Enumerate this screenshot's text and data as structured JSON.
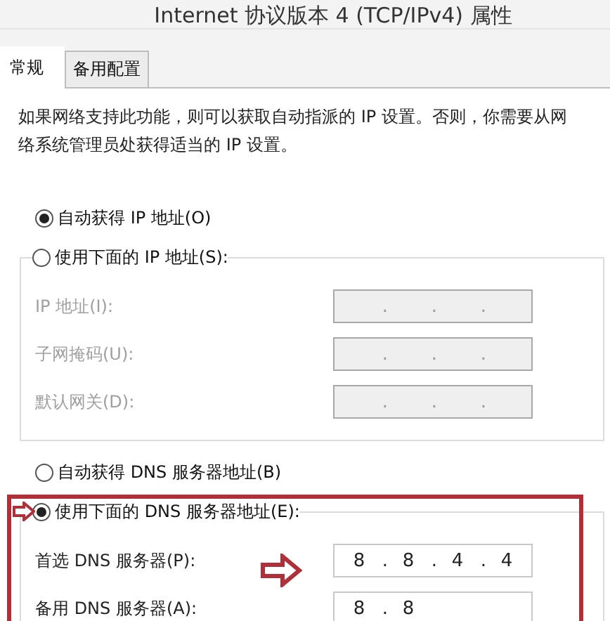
{
  "window": {
    "title": "Internet 协议版本 4 (TCP/IPv4) 属性"
  },
  "tabs": [
    {
      "label": "常规",
      "selected": true
    },
    {
      "label": "备用配置",
      "selected": false
    }
  ],
  "description": "如果网络支持此功能，则可以获取自动指派的 IP 设置。否则，你需要从网络系统管理员处获得适当的 IP 设置。",
  "ip_mode": [
    {
      "label": "自动获得 IP 地址(O)",
      "selected": true
    },
    {
      "label": "使用下面的 IP 地址(S):",
      "selected": false
    }
  ],
  "ip_fields": [
    {
      "label": "IP 地址(I):",
      "disabled": true,
      "separators": [
        ".",
        ".",
        "."
      ]
    },
    {
      "label": "子网掩码(U):",
      "disabled": true,
      "separators": [
        ".",
        ".",
        "."
      ]
    },
    {
      "label": "默认网关(D):",
      "disabled": true,
      "separators": [
        ".",
        ".",
        "."
      ]
    }
  ],
  "dns_mode": [
    {
      "label": "自动获得 DNS 服务器地址(B)",
      "selected": false
    },
    {
      "label": "使用下面的 DNS 服务器地址(E):",
      "selected": true
    }
  ],
  "dns_fields": [
    {
      "label": "首选 DNS 服务器(P):",
      "disabled": false,
      "octets": [
        "8",
        "8",
        "4",
        "4"
      ],
      "separators": [
        ".",
        ".",
        "."
      ]
    },
    {
      "label": "备用 DNS 服务器(A):",
      "disabled": false,
      "octets": [
        "8",
        "8"
      ],
      "separators": [
        "."
      ]
    }
  ]
}
